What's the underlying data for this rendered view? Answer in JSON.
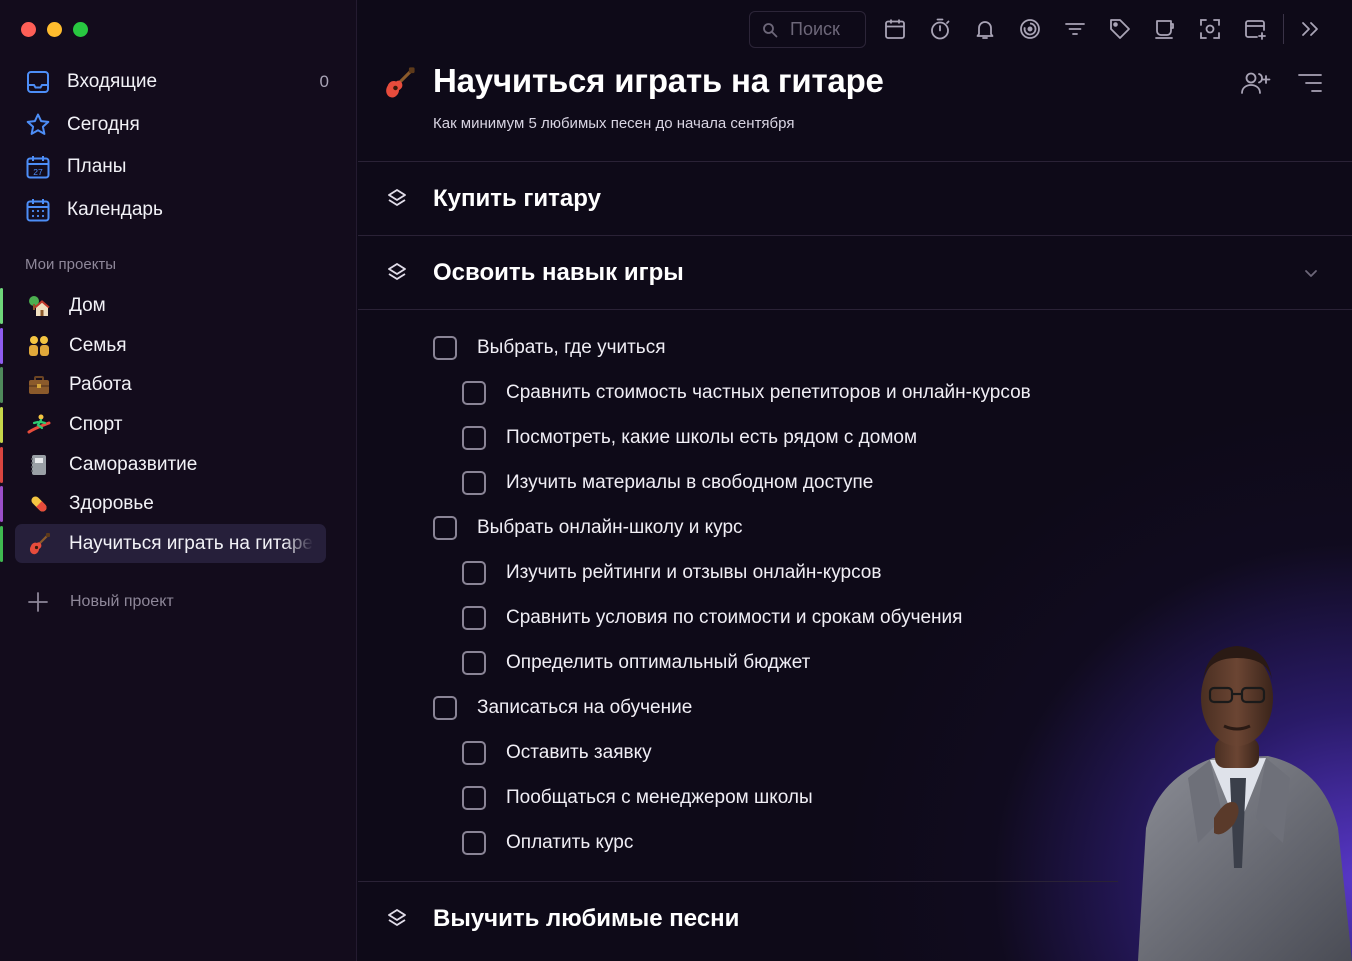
{
  "window": {
    "controls": [
      "close",
      "minimize",
      "maximize"
    ]
  },
  "sidebar": {
    "nav": [
      {
        "label": "Входящие",
        "count": "0",
        "icon": "inbox-icon"
      },
      {
        "label": "Сегодня",
        "icon": "star-icon"
      },
      {
        "label": "Планы",
        "icon": "calendar-27-icon"
      },
      {
        "label": "Календарь",
        "icon": "calendar-grid-icon"
      }
    ],
    "projects_title": "Мои проекты",
    "projects": [
      {
        "label": "Дом",
        "color": "#6fd67a",
        "emoji": "house-with-garden"
      },
      {
        "label": "Семья",
        "color": "#8f5cf0",
        "emoji": "family"
      },
      {
        "label": "Работа",
        "color": "#4f8a5b",
        "emoji": "briefcase"
      },
      {
        "label": "Спорт",
        "color": "#c6d64a",
        "emoji": "surfer"
      },
      {
        "label": "Саморазвитие",
        "color": "#d9453f",
        "emoji": "notebook"
      },
      {
        "label": "Здоровье",
        "color": "#9b4fc9",
        "emoji": "pill"
      },
      {
        "label": "Научиться играть на гитаре",
        "color": "#3fb950",
        "emoji": "guitar",
        "active": true
      }
    ],
    "new_project": "Новый проект"
  },
  "toolbar": {
    "search_placeholder": "Поиск",
    "icons": [
      "calendar-icon",
      "timer-icon",
      "bell-icon",
      "focus-icon",
      "filter-icon",
      "tag-icon",
      "coffee-cup-icon",
      "screenshot-icon",
      "add-window-icon",
      "double-chevron-right-icon"
    ]
  },
  "project": {
    "title": "Научиться играть на гитаре",
    "subtitle": "Как минимум 5 любимых песен до начала сентября"
  },
  "groups": [
    {
      "title": "Купить гитару"
    },
    {
      "title": "Освоить навык игры",
      "expanded": true
    },
    {
      "title": "Выучить любимые песни"
    }
  ],
  "tasks": [
    {
      "label": "Выбрать, где учиться",
      "level": 0
    },
    {
      "label": "Сравнить стоимость частных репетиторов и онлайн-курсов",
      "level": 1
    },
    {
      "label": "Посмотреть, какие школы есть рядом с домом",
      "level": 1
    },
    {
      "label": "Изучить материалы в свободном доступе",
      "level": 1
    },
    {
      "label": "Выбрать онлайн-школу и курс",
      "level": 0
    },
    {
      "label": "Изучить рейтинги и отзывы онлайн-курсов",
      "level": 1
    },
    {
      "label": "Сравнить условия по стоимости и срокам обучения",
      "level": 1
    },
    {
      "label": "Определить оптимальный бюджет",
      "level": 1
    },
    {
      "label": "Записаться на обучение",
      "level": 0
    },
    {
      "label": "Оставить заявку",
      "level": 1
    },
    {
      "label": "Пообщаться с менеджером школы",
      "level": 1
    },
    {
      "label": "Оплатить курс",
      "level": 1
    }
  ]
}
